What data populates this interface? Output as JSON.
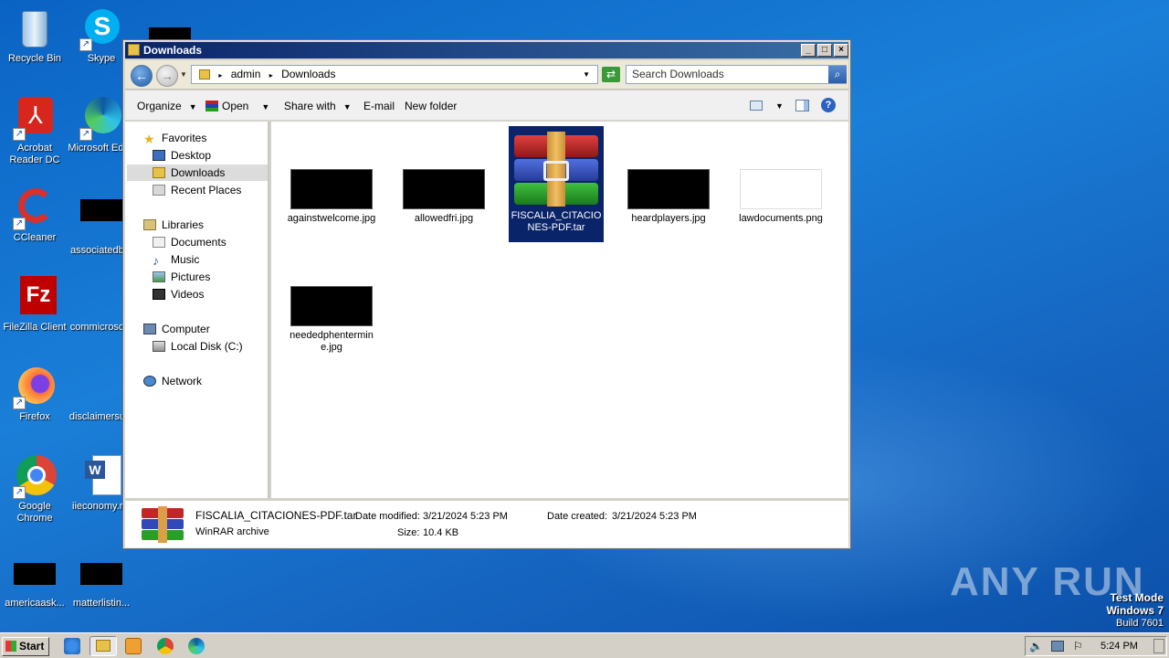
{
  "desktop": {
    "icons": [
      {
        "label": "Recycle Bin"
      },
      {
        "label": "Skype"
      },
      {
        "label": "Acrobat Reader DC"
      },
      {
        "label": "Microsoft Edge"
      },
      {
        "label": "CCleaner"
      },
      {
        "label": "associatedb..."
      },
      {
        "label": "FileZilla Client"
      },
      {
        "label": "commicroso..."
      },
      {
        "label": "Firefox"
      },
      {
        "label": "disclaimersu..."
      },
      {
        "label": "Google Chrome"
      },
      {
        "label": "iieconomy.r..."
      },
      {
        "label": "americaask..."
      },
      {
        "label": "matterlistin..."
      }
    ],
    "watermark": {
      "brand": "ANY RUN",
      "line1": "Test Mode",
      "line2": "Windows 7",
      "line3": "Build 7601"
    }
  },
  "window": {
    "title": "Downloads",
    "address": {
      "segments": [
        "admin",
        "Downloads"
      ]
    },
    "search": {
      "placeholder": "Search Downloads"
    },
    "toolbar": {
      "organize": "Organize",
      "open": "Open",
      "share": "Share with",
      "email": "E-mail",
      "new_folder": "New folder"
    },
    "nav": {
      "favorites": "Favorites",
      "desktop": "Desktop",
      "downloads": "Downloads",
      "recent": "Recent Places",
      "libraries": "Libraries",
      "documents": "Documents",
      "music": "Music",
      "pictures": "Pictures",
      "videos": "Videos",
      "computer": "Computer",
      "local_disk": "Local Disk (C:)",
      "network": "Network"
    },
    "files": [
      {
        "name": "againstwelcome.jpg"
      },
      {
        "name": "allowedfri.jpg"
      },
      {
        "name": "FISCALIA_CITACIONES-PDF.tar",
        "selected": true
      },
      {
        "name": "heardplayers.jpg"
      },
      {
        "name": "lawdocuments.png"
      },
      {
        "name": "neededphentermine.jpg"
      }
    ],
    "details": {
      "filename": "FISCALIA_CITACIONES-PDF.tar",
      "type": "WinRAR archive",
      "modified_label": "Date modified:",
      "modified": "3/21/2024 5:23 PM",
      "created_label": "Date created:",
      "created": "3/21/2024 5:23 PM",
      "size_label": "Size:",
      "size": "10.4 KB"
    }
  },
  "taskbar": {
    "start": "Start",
    "time": "5:24 PM"
  }
}
